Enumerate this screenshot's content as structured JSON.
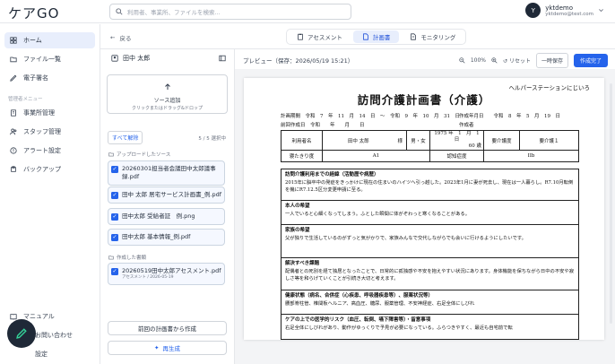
{
  "app": {
    "logo": "ケアGO"
  },
  "search": {
    "placeholder": "利用者、事業所、ファイルを検索..."
  },
  "user": {
    "initial": "Y",
    "name": "yktdemo",
    "email": "yktdemo@test.com"
  },
  "sidebar": {
    "items": [
      {
        "label": "ホーム",
        "icon": "home-icon",
        "active": true
      },
      {
        "label": "ファイル一覧",
        "icon": "folder-icon"
      },
      {
        "label": "電子署名",
        "icon": "signature-icon"
      }
    ],
    "manager_title": "管理者メニュー",
    "manager_items": [
      {
        "label": "事業所管理",
        "icon": "building-icon"
      },
      {
        "label": "スタッフ管理",
        "icon": "users-icon"
      },
      {
        "label": "アラート設定",
        "icon": "alert-icon"
      },
      {
        "label": "バックアップ",
        "icon": "backup-icon"
      }
    ],
    "bottom_items": [
      {
        "label": "マニュアル",
        "icon": "book-icon"
      },
      {
        "label": "お問い合わせ",
        "icon": "mail-icon"
      },
      {
        "label": "設定",
        "icon": "gear-icon"
      }
    ]
  },
  "tabbar": {
    "back": "戻る",
    "tabs": [
      {
        "label": "アセスメント",
        "icon": "clipboard-icon"
      },
      {
        "label": "計画書",
        "icon": "document-icon",
        "active": true
      },
      {
        "label": "モニタリング",
        "icon": "monitor-icon"
      }
    ]
  },
  "panel": {
    "client": "田中 太郎",
    "upload_title": "ソース追加",
    "upload_sub": "クリックまたはドラッグ&ドロップ",
    "deselect_all": "すべて解除",
    "selected_count": "5 / 5 選択中",
    "uploaded_title": "アップロードしたソース",
    "files": [
      "20260301担当者会議田中太郎議事録.pdf",
      "田中 太郎 居宅サービス計画書_例.pdf",
      "田中太郎 受給者証　例.png",
      "田中太郎 基本情報_例.pdf"
    ],
    "created_title": "作成した書類",
    "created": [
      {
        "name": "20260519田中太郎アセスメント.pdf",
        "sub": "アセスメント / 2026-05-19"
      }
    ],
    "from_prev": "前回の計画書から作成",
    "regenerate": "再生成"
  },
  "preview": {
    "title": "プレビュー（保存：2026/05/19 15:21）",
    "zoom": "100%",
    "reset": "リセット",
    "temp_save": "一時保存",
    "complete": "作成完了"
  },
  "doc": {
    "station": "ヘルパーステーションにじいろ",
    "title": "訪問介護計画書（介護）",
    "period": "計画期間　令和　7　年　11　月　14　日　〜　令和　9　年　10　月　31　日",
    "prev_date": "前回作成日　令和　　年　　月　　日",
    "created": "作成年月日　　令和　8　年　5　月　19　日",
    "author": "作成者",
    "row1": [
      "利用者名",
      "田中 太郎",
      "様",
      "男・女",
      "1975 年　1　月　1　日",
      "60 歳",
      "要介護度",
      "要介護１"
    ],
    "row2": [
      "寝たきり度",
      "A1",
      "認知症度",
      "IIb"
    ],
    "sections": [
      {
        "title": "訪問介護利用までの経緯（活動歴や病歴）",
        "body": "2015年に脳卒中の発症をきっかけに現在の住まいのハイツへ引っ越した。2023年1月に妻が死去し、現在は一人暮らし。R7.10月転倒を機にR7.12.5区分変更申請に至る。"
      },
      {
        "title": "本人の希望",
        "body": "一人でいると心細くなってしまう。ふとした瞬間に体がぞわっと寒くなることがある。"
      },
      {
        "title": "家族の希望",
        "body": "父が独りで生活しているのがずっと気がかりで、家族みんなで交代しながらでも会いに行けるようにしたいです。"
      },
      {
        "title": "解決すべき課題",
        "body": "配偶者との死別を経て独居となったことで、日常的に孤独感や不安を抱えやすい状況にあります。身体機能を保ちながら日中の不安や寂しさ等を和らげていくことが引続き大切と考えます。"
      },
      {
        "title": "健康状態（病名、合併症（心疾患、呼吸器疾患等）、服薬状況等）",
        "body": "腰部脊柱管、椎間板ヘルニア、高血圧、糖尿、服薬管理、不安神経症、右足全体にしびれ"
      },
      {
        "title": "ケアの上での医学的リスク（血圧、転倒、嚥下障害等）・留意事項",
        "body": "右足全体にしびれがあり、動作がゆっくりで予見が必要になっている。ふらつきやすく、最近も自宅前で転"
      }
    ]
  }
}
